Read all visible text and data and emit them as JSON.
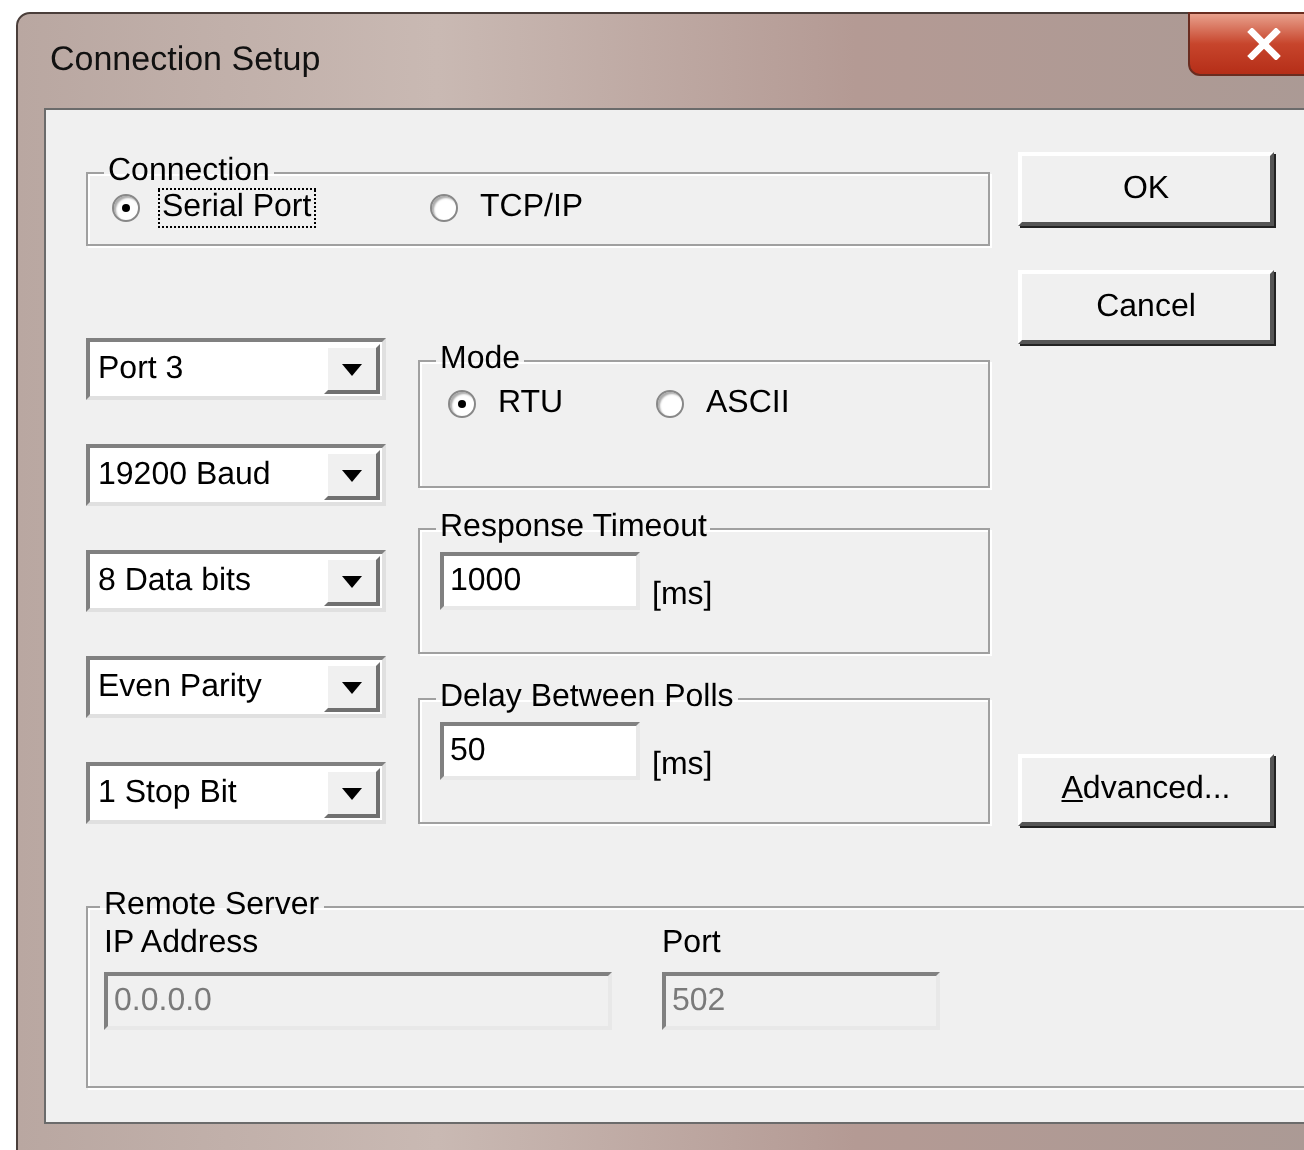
{
  "window": {
    "title": "Connection Setup"
  },
  "connection": {
    "label": "Connection",
    "options": [
      {
        "label": "Serial Port",
        "selected": true,
        "focused": true
      },
      {
        "label": "TCP/IP",
        "selected": false,
        "focused": false
      }
    ]
  },
  "serial_settings": [
    {
      "value": "Port 3"
    },
    {
      "value": "19200 Baud"
    },
    {
      "value": "8 Data bits"
    },
    {
      "value": "Even Parity"
    },
    {
      "value": "1 Stop Bit"
    }
  ],
  "mode": {
    "label": "Mode",
    "options": [
      {
        "label": "RTU",
        "selected": true,
        "focused": false
      },
      {
        "label": "ASCII",
        "selected": false,
        "focused": false
      }
    ]
  },
  "timings": [
    {
      "label": "Response Timeout",
      "value": "1000",
      "unit": "[ms]"
    },
    {
      "label": "Delay Between Polls",
      "value": "50",
      "unit": "[ms]"
    }
  ],
  "buttons": [
    {
      "label": "OK"
    },
    {
      "label": "Cancel"
    }
  ],
  "advanced_button": {
    "label": "Advanced...",
    "mnemonic": true
  },
  "remote_server": {
    "label": "Remote Server",
    "fields": [
      {
        "label": "IP Address",
        "value": "0.0.0.0",
        "disabled": true
      },
      {
        "label": "Port",
        "value": "502",
        "disabled": true
      }
    ]
  }
}
